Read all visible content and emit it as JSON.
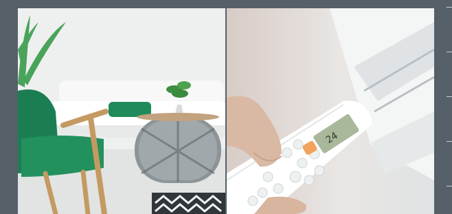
{
  "images": {
    "left": {
      "alt": "living-room-interior-photo"
    },
    "right": {
      "alt": "air-conditioner-remote-photo"
    }
  },
  "remote": {
    "display_value": "24"
  },
  "colors": {
    "background": "#556069",
    "accent_green": "#1f8a5a",
    "wall": "#eef0ef",
    "lcd": "#a9b89b",
    "button_orange": "#f2a35c"
  },
  "side_rules": {
    "count": 5
  }
}
